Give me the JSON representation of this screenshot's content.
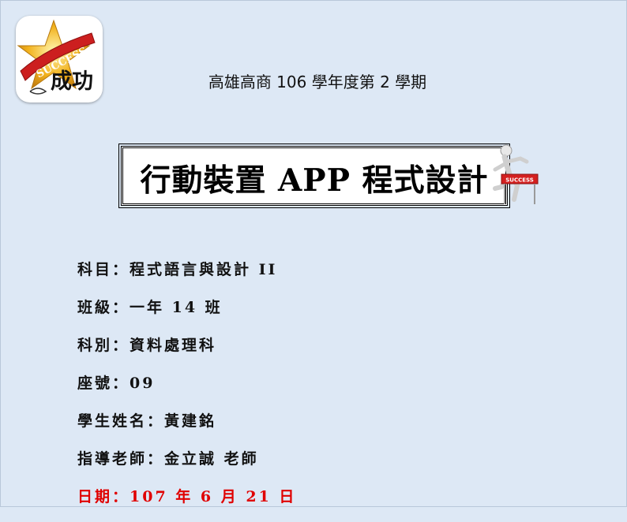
{
  "header": {
    "school_line": "高雄高商 106 學年度第 2 學期",
    "logo_text": "成功",
    "logo_banner": "SUCCESS"
  },
  "title": {
    "text": "行動裝置 APP 程式設計",
    "sign_text": "SUCCESS"
  },
  "info": [
    {
      "label": "科目：",
      "value": "程式語言與設計 II"
    },
    {
      "label": "班級：",
      "value": "一年  14  班"
    },
    {
      "label": "科別：",
      "value": "資料處理科"
    },
    {
      "label": "座號：",
      "value": "09"
    },
    {
      "label": "學生姓名：",
      "value": "黃建銘"
    },
    {
      "label": "指導老師：",
      "value": "金立誠  老師"
    },
    {
      "label": "日期：",
      "value": "107 年 6 月 21 日"
    }
  ],
  "colors": {
    "background": "#dde8f5",
    "date_text": "#e00000",
    "logo_banner": "#cc1f1f",
    "logo_star": "#f2b21d"
  }
}
